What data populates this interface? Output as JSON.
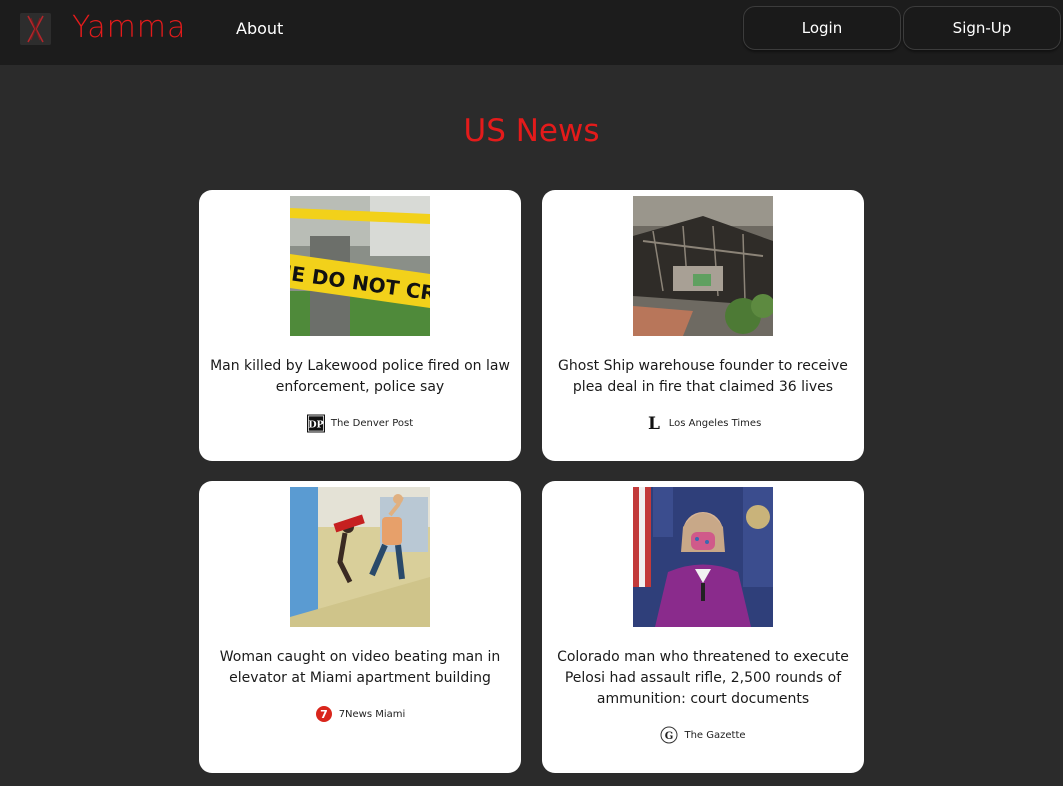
{
  "navbar": {
    "brand": "Yamma",
    "about": "About",
    "login": "Login",
    "signup": "Sign-Up"
  },
  "page": {
    "title": "US News"
  },
  "articles": [
    {
      "title": "Man killed by Lakewood police fired on law enforcement, police say",
      "source": "The Denver Post",
      "thumbnail": "crime-scene-tape-image",
      "logo_text": "DP"
    },
    {
      "title": "Ghost Ship warehouse founder to receive plea deal in fire that claimed 36 lives",
      "source": "Los Angeles Times",
      "thumbnail": "burned-warehouse-image",
      "logo_text": "L"
    },
    {
      "title": "Woman caught on video beating man in elevator at Miami apartment building",
      "source": "7News Miami",
      "thumbnail": "elevator-video-still-image",
      "logo_text": "7"
    },
    {
      "title": "Colorado man who threatened to execute Pelosi had assault rifle, 2,500 rounds of ammunition: court documents",
      "source": "The Gazette",
      "thumbnail": "pelosi-press-conference-image",
      "logo_text": "G"
    }
  ],
  "colors": {
    "accent": "#e41b1b",
    "background": "#2b2b2b",
    "navbar": "#1c1c1c",
    "card": "#ffffff"
  }
}
